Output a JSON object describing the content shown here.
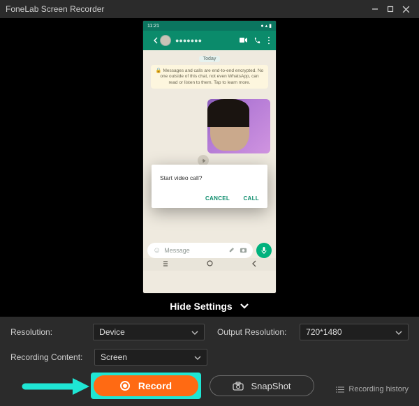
{
  "window": {
    "title": "FoneLab Screen Recorder"
  },
  "phone": {
    "time": "11:21",
    "contact": "●●●●●●●",
    "date_label": "Today",
    "encryption_notice": "Messages and calls are end-to-end encrypted. No one outside of this chat, not even WhatsApp, can read or listen to them. Tap to learn more.",
    "message_placeholder": "Message",
    "dialog": {
      "question": "Start video call?",
      "cancel": "CANCEL",
      "call": "CALL"
    }
  },
  "settings": {
    "hide_label": "Hide Settings",
    "resolution_label": "Resolution:",
    "resolution_value": "Device",
    "output_res_label": "Output Resolution:",
    "output_res_value": "720*1480",
    "recording_content_label": "Recording Content:",
    "recording_content_value": "Screen"
  },
  "actions": {
    "record": "Record",
    "snapshot": "SnapShot",
    "history": "Recording history"
  }
}
